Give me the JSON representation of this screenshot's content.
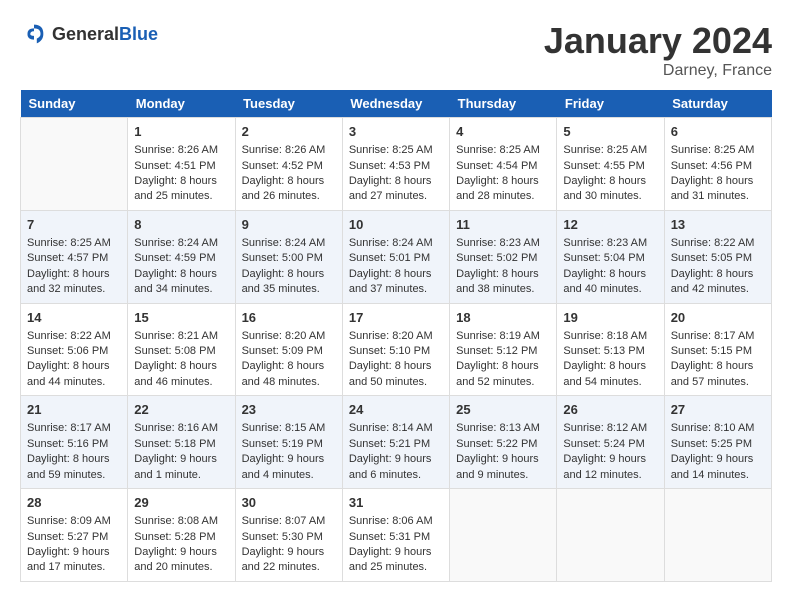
{
  "header": {
    "logo_general": "General",
    "logo_blue": "Blue",
    "month_year": "January 2024",
    "location": "Darney, France"
  },
  "days_of_week": [
    "Sunday",
    "Monday",
    "Tuesday",
    "Wednesday",
    "Thursday",
    "Friday",
    "Saturday"
  ],
  "weeks": [
    [
      {
        "day": "",
        "sunrise": "",
        "sunset": "",
        "daylight": ""
      },
      {
        "day": "1",
        "sunrise": "Sunrise: 8:26 AM",
        "sunset": "Sunset: 4:51 PM",
        "daylight": "Daylight: 8 hours and 25 minutes."
      },
      {
        "day": "2",
        "sunrise": "Sunrise: 8:26 AM",
        "sunset": "Sunset: 4:52 PM",
        "daylight": "Daylight: 8 hours and 26 minutes."
      },
      {
        "day": "3",
        "sunrise": "Sunrise: 8:25 AM",
        "sunset": "Sunset: 4:53 PM",
        "daylight": "Daylight: 8 hours and 27 minutes."
      },
      {
        "day": "4",
        "sunrise": "Sunrise: 8:25 AM",
        "sunset": "Sunset: 4:54 PM",
        "daylight": "Daylight: 8 hours and 28 minutes."
      },
      {
        "day": "5",
        "sunrise": "Sunrise: 8:25 AM",
        "sunset": "Sunset: 4:55 PM",
        "daylight": "Daylight: 8 hours and 30 minutes."
      },
      {
        "day": "6",
        "sunrise": "Sunrise: 8:25 AM",
        "sunset": "Sunset: 4:56 PM",
        "daylight": "Daylight: 8 hours and 31 minutes."
      }
    ],
    [
      {
        "day": "7",
        "sunrise": "Sunrise: 8:25 AM",
        "sunset": "Sunset: 4:57 PM",
        "daylight": "Daylight: 8 hours and 32 minutes."
      },
      {
        "day": "8",
        "sunrise": "Sunrise: 8:24 AM",
        "sunset": "Sunset: 4:59 PM",
        "daylight": "Daylight: 8 hours and 34 minutes."
      },
      {
        "day": "9",
        "sunrise": "Sunrise: 8:24 AM",
        "sunset": "Sunset: 5:00 PM",
        "daylight": "Daylight: 8 hours and 35 minutes."
      },
      {
        "day": "10",
        "sunrise": "Sunrise: 8:24 AM",
        "sunset": "Sunset: 5:01 PM",
        "daylight": "Daylight: 8 hours and 37 minutes."
      },
      {
        "day": "11",
        "sunrise": "Sunrise: 8:23 AM",
        "sunset": "Sunset: 5:02 PM",
        "daylight": "Daylight: 8 hours and 38 minutes."
      },
      {
        "day": "12",
        "sunrise": "Sunrise: 8:23 AM",
        "sunset": "Sunset: 5:04 PM",
        "daylight": "Daylight: 8 hours and 40 minutes."
      },
      {
        "day": "13",
        "sunrise": "Sunrise: 8:22 AM",
        "sunset": "Sunset: 5:05 PM",
        "daylight": "Daylight: 8 hours and 42 minutes."
      }
    ],
    [
      {
        "day": "14",
        "sunrise": "Sunrise: 8:22 AM",
        "sunset": "Sunset: 5:06 PM",
        "daylight": "Daylight: 8 hours and 44 minutes."
      },
      {
        "day": "15",
        "sunrise": "Sunrise: 8:21 AM",
        "sunset": "Sunset: 5:08 PM",
        "daylight": "Daylight: 8 hours and 46 minutes."
      },
      {
        "day": "16",
        "sunrise": "Sunrise: 8:20 AM",
        "sunset": "Sunset: 5:09 PM",
        "daylight": "Daylight: 8 hours and 48 minutes."
      },
      {
        "day": "17",
        "sunrise": "Sunrise: 8:20 AM",
        "sunset": "Sunset: 5:10 PM",
        "daylight": "Daylight: 8 hours and 50 minutes."
      },
      {
        "day": "18",
        "sunrise": "Sunrise: 8:19 AM",
        "sunset": "Sunset: 5:12 PM",
        "daylight": "Daylight: 8 hours and 52 minutes."
      },
      {
        "day": "19",
        "sunrise": "Sunrise: 8:18 AM",
        "sunset": "Sunset: 5:13 PM",
        "daylight": "Daylight: 8 hours and 54 minutes."
      },
      {
        "day": "20",
        "sunrise": "Sunrise: 8:17 AM",
        "sunset": "Sunset: 5:15 PM",
        "daylight": "Daylight: 8 hours and 57 minutes."
      }
    ],
    [
      {
        "day": "21",
        "sunrise": "Sunrise: 8:17 AM",
        "sunset": "Sunset: 5:16 PM",
        "daylight": "Daylight: 8 hours and 59 minutes."
      },
      {
        "day": "22",
        "sunrise": "Sunrise: 8:16 AM",
        "sunset": "Sunset: 5:18 PM",
        "daylight": "Daylight: 9 hours and 1 minute."
      },
      {
        "day": "23",
        "sunrise": "Sunrise: 8:15 AM",
        "sunset": "Sunset: 5:19 PM",
        "daylight": "Daylight: 9 hours and 4 minutes."
      },
      {
        "day": "24",
        "sunrise": "Sunrise: 8:14 AM",
        "sunset": "Sunset: 5:21 PM",
        "daylight": "Daylight: 9 hours and 6 minutes."
      },
      {
        "day": "25",
        "sunrise": "Sunrise: 8:13 AM",
        "sunset": "Sunset: 5:22 PM",
        "daylight": "Daylight: 9 hours and 9 minutes."
      },
      {
        "day": "26",
        "sunrise": "Sunrise: 8:12 AM",
        "sunset": "Sunset: 5:24 PM",
        "daylight": "Daylight: 9 hours and 12 minutes."
      },
      {
        "day": "27",
        "sunrise": "Sunrise: 8:10 AM",
        "sunset": "Sunset: 5:25 PM",
        "daylight": "Daylight: 9 hours and 14 minutes."
      }
    ],
    [
      {
        "day": "28",
        "sunrise": "Sunrise: 8:09 AM",
        "sunset": "Sunset: 5:27 PM",
        "daylight": "Daylight: 9 hours and 17 minutes."
      },
      {
        "day": "29",
        "sunrise": "Sunrise: 8:08 AM",
        "sunset": "Sunset: 5:28 PM",
        "daylight": "Daylight: 9 hours and 20 minutes."
      },
      {
        "day": "30",
        "sunrise": "Sunrise: 8:07 AM",
        "sunset": "Sunset: 5:30 PM",
        "daylight": "Daylight: 9 hours and 22 minutes."
      },
      {
        "day": "31",
        "sunrise": "Sunrise: 8:06 AM",
        "sunset": "Sunset: 5:31 PM",
        "daylight": "Daylight: 9 hours and 25 minutes."
      },
      {
        "day": "",
        "sunrise": "",
        "sunset": "",
        "daylight": ""
      },
      {
        "day": "",
        "sunrise": "",
        "sunset": "",
        "daylight": ""
      },
      {
        "day": "",
        "sunrise": "",
        "sunset": "",
        "daylight": ""
      }
    ]
  ]
}
